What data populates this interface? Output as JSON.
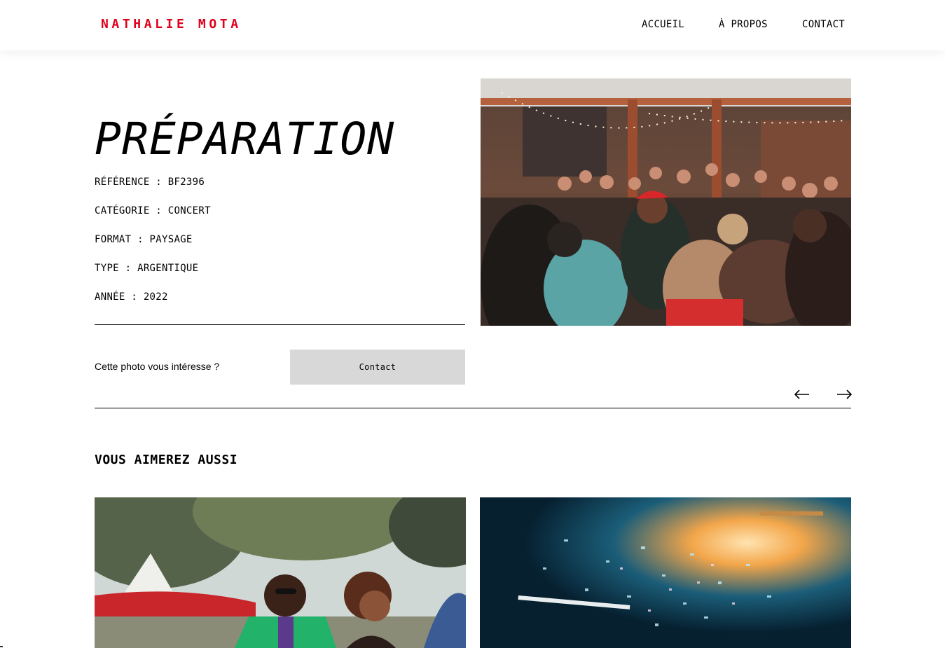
{
  "header": {
    "logo": "NATHALIE MOTA",
    "nav": [
      "ACCUEIL",
      "À PROPOS",
      "CONTACT"
    ]
  },
  "photo": {
    "title": "PRÉPARATION",
    "details": [
      "RÉFÉRENCE : BF2396",
      "CATÉGORIE : CONCERT",
      "FORMAT : PAYSAGE",
      "TYPE : ARGENTIQUE",
      "ANNÉE : 2022"
    ],
    "image_icon": "party-crowd-photo"
  },
  "interest": {
    "text": "Cette photo vous intéresse ?",
    "button_label": "Contact"
  },
  "navigation": {
    "prev_icon": "arrow-left-icon",
    "next_icon": "arrow-right-icon"
  },
  "related": {
    "title": "VOUS AIMEREZ AUSSI",
    "thumbnails": [
      "couple-festival-photo",
      "confetti-concert-photo"
    ]
  },
  "colors": {
    "logo_red": "#e0001b",
    "button_gray": "#d8d8d8",
    "text": "#000000",
    "background": "#ffffff"
  }
}
